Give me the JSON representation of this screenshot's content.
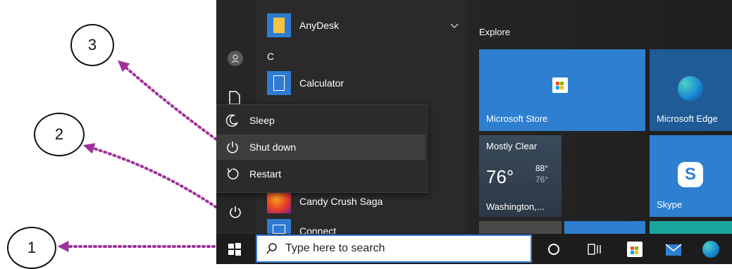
{
  "callouts": [
    "3",
    "2",
    "1"
  ],
  "applist": {
    "apps": [
      {
        "label": "AnyDesk"
      },
      {
        "label": "Calculator"
      },
      {
        "label": "Candy Crush Saga"
      },
      {
        "label": "Connect"
      }
    ],
    "section_letter": "C"
  },
  "power_menu": {
    "items": [
      {
        "label": "Sleep",
        "icon": "moon-icon"
      },
      {
        "label": "Shut down",
        "icon": "power-icon"
      },
      {
        "label": "Restart",
        "icon": "restart-icon"
      }
    ]
  },
  "explore": {
    "heading": "Explore",
    "tiles": {
      "store": "Microsoft Store",
      "edge": "Microsoft Edge",
      "skype": "Skype"
    },
    "weather": {
      "condition": "Mostly Clear",
      "temp": "76°",
      "high": "88°",
      "low": "76°",
      "location": "Washington,..."
    }
  },
  "taskbar": {
    "search_placeholder": "Type here to search"
  },
  "colors": {
    "accent": "#0078d4",
    "arrow": "#a0309a",
    "search_border": "#3a7bd5"
  }
}
